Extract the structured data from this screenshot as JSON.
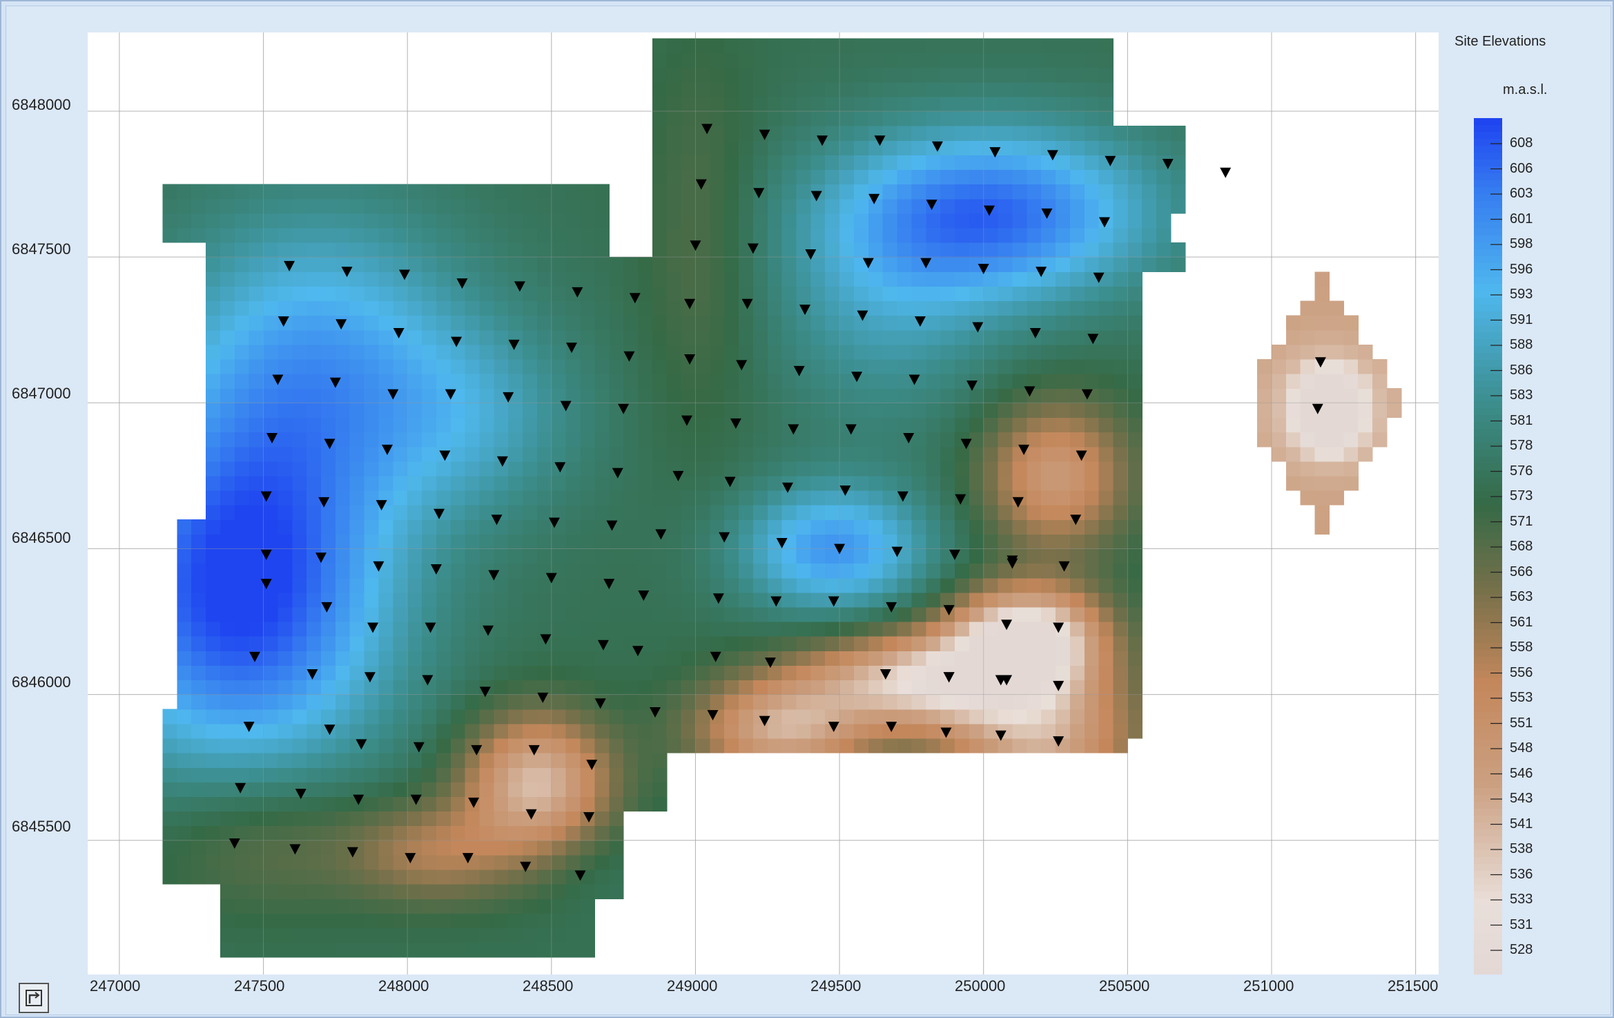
{
  "legend": {
    "title": "Site Elevations",
    "unit": "m.a.s.l.",
    "labels": [
      "608",
      "606",
      "603",
      "601",
      "598",
      "596",
      "593",
      "591",
      "588",
      "586",
      "583",
      "581",
      "578",
      "576",
      "573",
      "571",
      "568",
      "566",
      "563",
      "561",
      "558",
      "556",
      "553",
      "551",
      "548",
      "546",
      "543",
      "541",
      "538",
      "536",
      "533",
      "531",
      "528"
    ],
    "colors": {
      "high_blue": "#1f45f0",
      "light_blue": "#4fb8ee",
      "teal": "#3c8e8e",
      "green": "#356a46",
      "olive": "#75704a",
      "brown": "#c4875b",
      "pale": "#e3d8d4"
    }
  },
  "x_axis": {
    "ticks": [
      "247000",
      "247500",
      "248000",
      "248500",
      "249000",
      "249500",
      "250000",
      "250500",
      "251000",
      "251500"
    ]
  },
  "y_axis": {
    "ticks": [
      "6848000",
      "6847500",
      "6847000",
      "6846500",
      "6846000",
      "6845500"
    ]
  },
  "map": {
    "x_range": [
      246890,
      251580
    ],
    "y_range": [
      6845040,
      6848270
    ],
    "elevation_range": [
      527,
      609
    ],
    "sites": [
      [
        247590,
        6847470
      ],
      [
        247790,
        6847450
      ],
      [
        247990,
        6847440
      ],
      [
        248190,
        6847410
      ],
      [
        248390,
        6847400
      ],
      [
        248590,
        6847380
      ],
      [
        248790,
        6847360
      ],
      [
        247570,
        6847280
      ],
      [
        247770,
        6847270
      ],
      [
        247970,
        6847240
      ],
      [
        248170,
        6847210
      ],
      [
        248370,
        6847200
      ],
      [
        248570,
        6847190
      ],
      [
        248770,
        6847160
      ],
      [
        247550,
        6847080
      ],
      [
        247750,
        6847070
      ],
      [
        247950,
        6847030
      ],
      [
        248150,
        6847030
      ],
      [
        248350,
        6847020
      ],
      [
        248550,
        6846990
      ],
      [
        248750,
        6846980
      ],
      [
        247530,
        6846880
      ],
      [
        247730,
        6846860
      ],
      [
        247930,
        6846840
      ],
      [
        248130,
        6846820
      ],
      [
        248330,
        6846800
      ],
      [
        248530,
        6846780
      ],
      [
        248730,
        6846760
      ],
      [
        247510,
        6846680
      ],
      [
        247710,
        6846660
      ],
      [
        247910,
        6846650
      ],
      [
        248110,
        6846620
      ],
      [
        248310,
        6846600
      ],
      [
        248510,
        6846590
      ],
      [
        248710,
        6846580
      ],
      [
        247510,
        6846480
      ],
      [
        247700,
        6846470
      ],
      [
        247900,
        6846440
      ],
      [
        248100,
        6846430
      ],
      [
        248300,
        6846410
      ],
      [
        248500,
        6846400
      ],
      [
        248700,
        6846380
      ],
      [
        247510,
        6846380
      ],
      [
        247720,
        6846300
      ],
      [
        247880,
        6846230
      ],
      [
        248080,
        6846230
      ],
      [
        248280,
        6846220
      ],
      [
        248480,
        6846190
      ],
      [
        248680,
        6846170
      ],
      [
        247470,
        6846130
      ],
      [
        247670,
        6846070
      ],
      [
        247870,
        6846060
      ],
      [
        248070,
        6846050
      ],
      [
        248270,
        6846010
      ],
      [
        248470,
        6845990
      ],
      [
        248670,
        6845970
      ],
      [
        247450,
        6845890
      ],
      [
        247730,
        6845880
      ],
      [
        247840,
        6845830
      ],
      [
        248040,
        6845820
      ],
      [
        248240,
        6845810
      ],
      [
        248440,
        6845810
      ],
      [
        248640,
        6845760
      ],
      [
        247420,
        6845680
      ],
      [
        247630,
        6845660
      ],
      [
        247830,
        6845640
      ],
      [
        248030,
        6845640
      ],
      [
        248230,
        6845630
      ],
      [
        248430,
        6845590
      ],
      [
        248630,
        6845580
      ],
      [
        247400,
        6845490
      ],
      [
        247610,
        6845470
      ],
      [
        247810,
        6845460
      ],
      [
        248010,
        6845440
      ],
      [
        248210,
        6845440
      ],
      [
        248410,
        6845410
      ],
      [
        248600,
        6845380
      ],
      [
        249040,
        6847940
      ],
      [
        249240,
        6847920
      ],
      [
        249440,
        6847900
      ],
      [
        249640,
        6847900
      ],
      [
        249840,
        6847880
      ],
      [
        250040,
        6847860
      ],
      [
        250240,
        6847850
      ],
      [
        250440,
        6847830
      ],
      [
        250640,
        6847820
      ],
      [
        250840,
        6847790
      ],
      [
        249020,
        6847750
      ],
      [
        249220,
        6847720
      ],
      [
        249420,
        6847710
      ],
      [
        249620,
        6847700
      ],
      [
        249820,
        6847680
      ],
      [
        250020,
        6847660
      ],
      [
        250220,
        6847650
      ],
      [
        250420,
        6847620
      ],
      [
        249000,
        6847540
      ],
      [
        249200,
        6847530
      ],
      [
        249400,
        6847510
      ],
      [
        249600,
        6847480
      ],
      [
        249800,
        6847480
      ],
      [
        250000,
        6847460
      ],
      [
        250200,
        6847450
      ],
      [
        250400,
        6847430
      ],
      [
        248980,
        6847340
      ],
      [
        249180,
        6847340
      ],
      [
        249380,
        6847320
      ],
      [
        249580,
        6847300
      ],
      [
        249780,
        6847280
      ],
      [
        249980,
        6847260
      ],
      [
        250180,
        6847240
      ],
      [
        250380,
        6847220
      ],
      [
        248980,
        6847150
      ],
      [
        249160,
        6847130
      ],
      [
        249360,
        6847110
      ],
      [
        249560,
        6847090
      ],
      [
        249760,
        6847080
      ],
      [
        249960,
        6847060
      ],
      [
        250160,
        6847040
      ],
      [
        250360,
        6847030
      ],
      [
        248970,
        6846940
      ],
      [
        249140,
        6846930
      ],
      [
        249340,
        6846910
      ],
      [
        249540,
        6846910
      ],
      [
        249740,
        6846880
      ],
      [
        249940,
        6846860
      ],
      [
        250140,
        6846840
      ],
      [
        250340,
        6846820
      ],
      [
        248940,
        6846750
      ],
      [
        249120,
        6846730
      ],
      [
        249320,
        6846710
      ],
      [
        249520,
        6846700
      ],
      [
        249720,
        6846680
      ],
      [
        249920,
        6846670
      ],
      [
        250120,
        6846660
      ],
      [
        250320,
        6846600
      ],
      [
        248880,
        6846550
      ],
      [
        249100,
        6846540
      ],
      [
        249300,
        6846520
      ],
      [
        249500,
        6846500
      ],
      [
        249700,
        6846490
      ],
      [
        249900,
        6846480
      ],
      [
        250100,
        6846450
      ],
      [
        250280,
        6846440
      ],
      [
        248820,
        6846340
      ],
      [
        249080,
        6846330
      ],
      [
        249280,
        6846320
      ],
      [
        249480,
        6846320
      ],
      [
        249680,
        6846300
      ],
      [
        249880,
        6846290
      ],
      [
        250080,
        6846240
      ],
      [
        250260,
        6846230
      ],
      [
        248800,
        6846150
      ],
      [
        249070,
        6846130
      ],
      [
        249260,
        6846110
      ],
      [
        249660,
        6846070
      ],
      [
        249880,
        6846060
      ],
      [
        250060,
        6846050
      ],
      [
        250260,
        6846030
      ],
      [
        248860,
        6845940
      ],
      [
        249060,
        6845930
      ],
      [
        249240,
        6845910
      ],
      [
        249480,
        6845890
      ],
      [
        249680,
        6845890
      ],
      [
        249870,
        6845870
      ],
      [
        250060,
        6845860
      ],
      [
        250260,
        6845840
      ],
      [
        249880,
        6846060
      ],
      [
        250080,
        6846050
      ],
      [
        250120,
        6846660
      ],
      [
        250100,
        6846460
      ],
      [
        251170,
        6847140
      ],
      [
        251160,
        6846980
      ]
    ]
  }
}
